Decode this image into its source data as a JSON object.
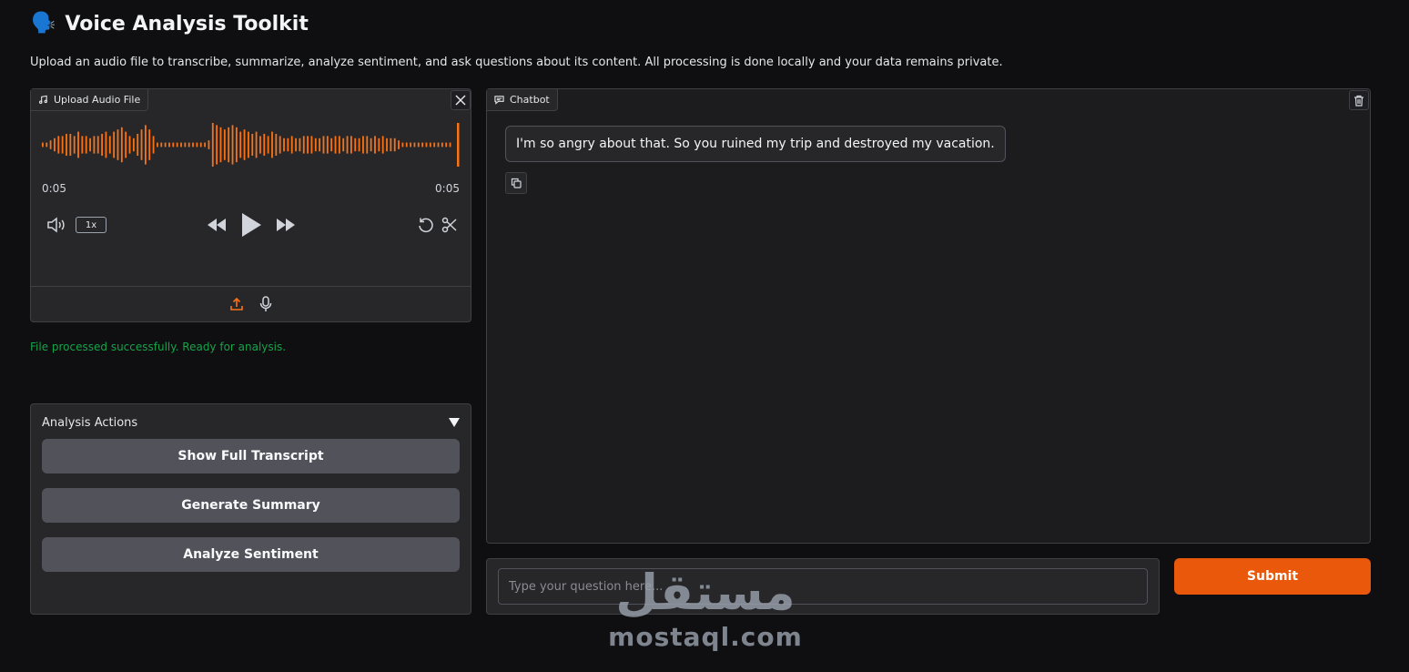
{
  "app": {
    "title": "Voice Analysis Toolkit",
    "title_emoji": "🗣️",
    "description": "Upload an audio file to transcribe, summarize, analyze sentiment, and ask questions about its content. All processing is done locally and your data remains private."
  },
  "audio": {
    "label": "Upload Audio File",
    "current_time": "0:05",
    "duration": "0:05",
    "playback_speed": "1x",
    "waveform_color": "#f97316",
    "icons": [
      "music-icon",
      "close-icon",
      "volume-icon",
      "rewind-icon",
      "play-icon",
      "fast-forward-icon",
      "reset-icon",
      "scissors-icon",
      "upload-icon",
      "microphone-icon"
    ]
  },
  "status": {
    "message": "File processed successfully. Ready for analysis.",
    "color": "#16a34a"
  },
  "actions": {
    "header": "Analysis Actions",
    "buttons": [
      "Show Full Transcript",
      "Generate Summary",
      "Analyze Sentiment"
    ]
  },
  "chatbot": {
    "label": "Chatbot",
    "messages": [
      {
        "text": "I'm so angry about that. So you ruined my trip and destroyed my vacation."
      }
    ]
  },
  "question": {
    "placeholder": "Type your question here...",
    "value": ""
  },
  "submit_label": "Submit",
  "colors": {
    "accent": "#ea580c",
    "background": "#0f0f11",
    "panel": "#27272a"
  },
  "watermark": {
    "arabic": "مستقل",
    "latin": "mostaql.com"
  }
}
